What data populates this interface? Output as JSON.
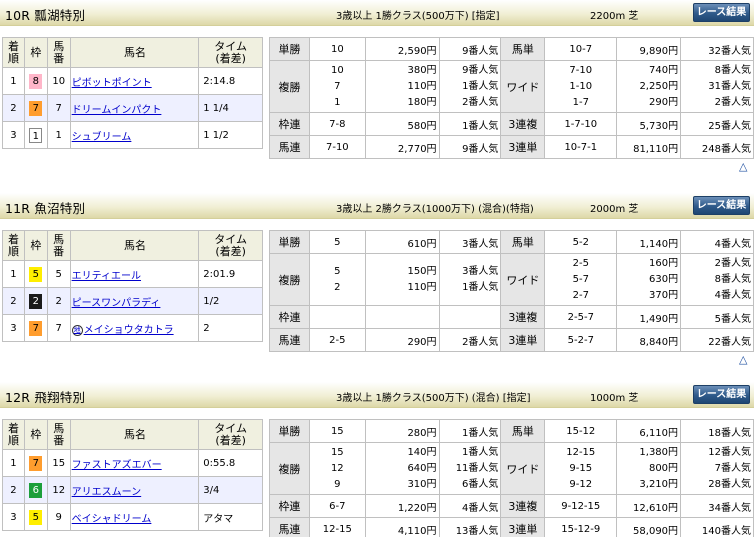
{
  "rank_labels": [
    "1",
    "2",
    "3"
  ],
  "labels": {
    "result_header": {
      "rank": "着\n順",
      "waku": "枠",
      "num": "馬\n番",
      "name": "馬名",
      "time": "タイム\n(着差)"
    },
    "bet_types": {
      "win": "単勝",
      "place": "複勝",
      "bracket": "枠連",
      "quinella": "馬連",
      "exacta": "馬単",
      "wide": "ワイド",
      "trio": "3連複",
      "trifecta": "3連単"
    },
    "button": "レース結果",
    "top_arrow": "△"
  },
  "races": [
    {
      "title": "10R 瓢湖特別",
      "conditions": "3歳以上 1勝クラス(500万下) [指定]",
      "distance": "2200m 芝",
      "results": [
        {
          "waku": "8",
          "waku_color": "#ffb6c9",
          "num": "10",
          "name": "ピボットポイント",
          "time": "2:14.8",
          "marker": ""
        },
        {
          "waku": "7",
          "waku_color": "#ff9d2e",
          "num": "7",
          "name": "ドリームインパクト",
          "time": "1 1/4",
          "marker": ""
        },
        {
          "waku": "1",
          "waku_color": "#ffffff",
          "num": "1",
          "name": "シュブリーム",
          "time": "1 1/2",
          "marker": ""
        }
      ],
      "payouts": {
        "win": [
          {
            "combo": "10",
            "amount": "2,590円",
            "pop": "9番人気"
          }
        ],
        "place": [
          {
            "combo": "10",
            "amount": "380円",
            "pop": "9番人気"
          },
          {
            "combo": "7",
            "amount": "110円",
            "pop": "1番人気"
          },
          {
            "combo": "1",
            "amount": "180円",
            "pop": "2番人気"
          }
        ],
        "bracket": [
          {
            "combo": "7-8",
            "amount": "580円",
            "pop": "1番人気"
          }
        ],
        "quinella": [
          {
            "combo": "7-10",
            "amount": "2,770円",
            "pop": "9番人気"
          }
        ],
        "exacta": [
          {
            "combo": "10-7",
            "amount": "9,890円",
            "pop": "32番人気"
          }
        ],
        "wide": [
          {
            "combo": "7-10",
            "amount": "740円",
            "pop": "8番人気"
          },
          {
            "combo": "1-10",
            "amount": "2,250円",
            "pop": "31番人気"
          },
          {
            "combo": "1-7",
            "amount": "290円",
            "pop": "2番人気"
          }
        ],
        "trio": [
          {
            "combo": "1-7-10",
            "amount": "5,730円",
            "pop": "25番人気"
          }
        ],
        "trifecta": [
          {
            "combo": "10-7-1",
            "amount": "81,110円",
            "pop": "248番人気"
          }
        ]
      }
    },
    {
      "title": "11R 魚沼特別",
      "conditions": "3歳以上 2勝クラス(1000万下) (混合)(特指)",
      "distance": "2000m 芝",
      "results": [
        {
          "waku": "5",
          "waku_color": "#ffee00",
          "num": "5",
          "name": "エリティエール",
          "time": "2:01.9",
          "marker": ""
        },
        {
          "waku": "2",
          "waku_color": "#1a1a1a",
          "num": "2",
          "name": "ピースワンパラディ",
          "time": "1/2",
          "marker": ""
        },
        {
          "waku": "7",
          "waku_color": "#ff9d2e",
          "num": "7",
          "name": "メイショウタカトラ",
          "time": "2",
          "marker": "地"
        }
      ],
      "payouts": {
        "win": [
          {
            "combo": "5",
            "amount": "610円",
            "pop": "3番人気"
          }
        ],
        "place": [
          {
            "combo": "5",
            "amount": "150円",
            "pop": "3番人気"
          },
          {
            "combo": "2",
            "amount": "110円",
            "pop": "1番人気"
          }
        ],
        "bracket": [
          {
            "combo": "",
            "amount": "",
            "pop": ""
          }
        ],
        "quinella": [
          {
            "combo": "2-5",
            "amount": "290円",
            "pop": "2番人気"
          }
        ],
        "exacta": [
          {
            "combo": "5-2",
            "amount": "1,140円",
            "pop": "4番人気"
          }
        ],
        "wide": [
          {
            "combo": "2-5",
            "amount": "160円",
            "pop": "2番人気"
          },
          {
            "combo": "5-7",
            "amount": "630円",
            "pop": "8番人気"
          },
          {
            "combo": "2-7",
            "amount": "370円",
            "pop": "4番人気"
          }
        ],
        "trio": [
          {
            "combo": "2-5-7",
            "amount": "1,490円",
            "pop": "5番人気"
          }
        ],
        "trifecta": [
          {
            "combo": "5-2-7",
            "amount": "8,840円",
            "pop": "22番人気"
          }
        ]
      }
    },
    {
      "title": "12R 飛翔特別",
      "conditions": "3歳以上 1勝クラス(500万下) (混合) [指定]",
      "distance": "1000m 芝",
      "results": [
        {
          "waku": "7",
          "waku_color": "#ff9d2e",
          "num": "15",
          "name": "ファストアズエバー",
          "time": "0:55.8",
          "marker": ""
        },
        {
          "waku": "6",
          "waku_color": "#1c9f3a",
          "num": "12",
          "name": "アリエスムーン",
          "time": "3/4",
          "marker": ""
        },
        {
          "waku": "5",
          "waku_color": "#ffee00",
          "num": "9",
          "name": "ベイシャドリーム",
          "time": "アタマ",
          "marker": ""
        }
      ],
      "payouts": {
        "win": [
          {
            "combo": "15",
            "amount": "280円",
            "pop": "1番人気"
          }
        ],
        "place": [
          {
            "combo": "15",
            "amount": "140円",
            "pop": "1番人気"
          },
          {
            "combo": "12",
            "amount": "640円",
            "pop": "11番人気"
          },
          {
            "combo": "9",
            "amount": "310円",
            "pop": "6番人気"
          }
        ],
        "bracket": [
          {
            "combo": "6-7",
            "amount": "1,220円",
            "pop": "4番人気"
          }
        ],
        "quinella": [
          {
            "combo": "12-15",
            "amount": "4,110円",
            "pop": "13番人気"
          }
        ],
        "exacta": [
          {
            "combo": "15-12",
            "amount": "6,110円",
            "pop": "18番人気"
          }
        ],
        "wide": [
          {
            "combo": "12-15",
            "amount": "1,380円",
            "pop": "12番人気"
          },
          {
            "combo": "9-15",
            "amount": "800円",
            "pop": "7番人気"
          },
          {
            "combo": "9-12",
            "amount": "3,210円",
            "pop": "28番人気"
          }
        ],
        "trio": [
          {
            "combo": "9-12-15",
            "amount": "12,610円",
            "pop": "34番人気"
          }
        ],
        "trifecta": [
          {
            "combo": "15-12-9",
            "amount": "58,090円",
            "pop": "140番人気"
          }
        ]
      }
    }
  ]
}
